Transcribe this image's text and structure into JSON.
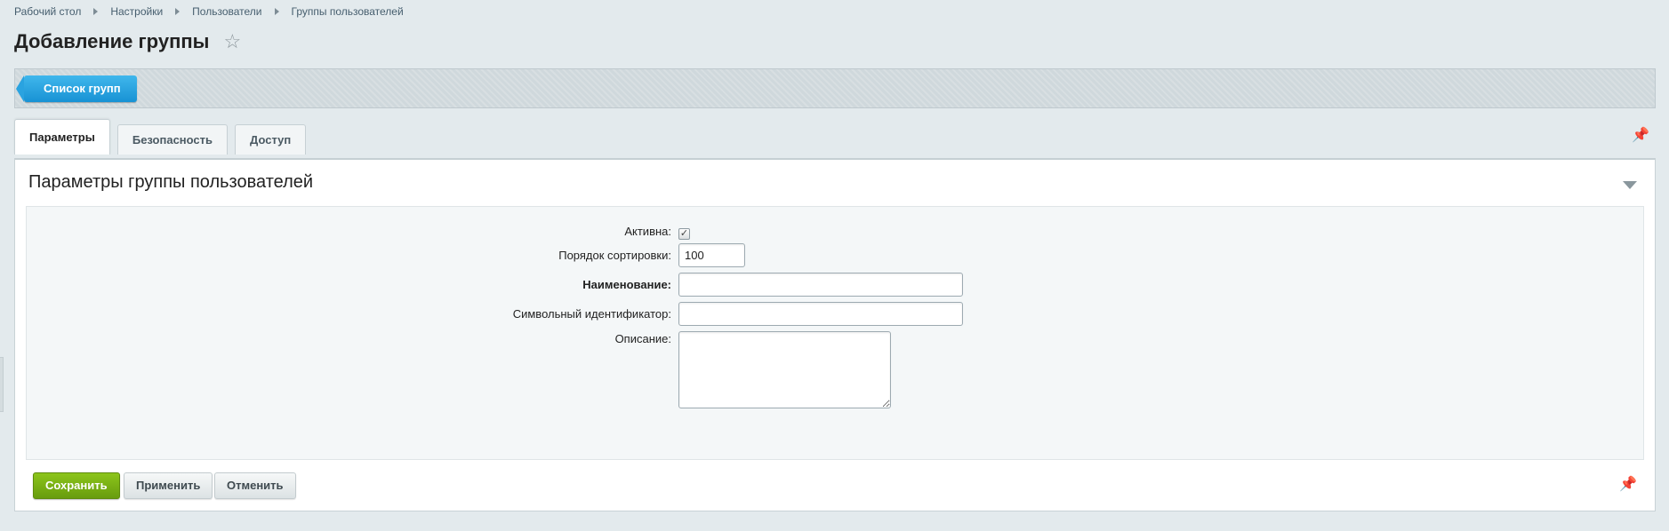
{
  "breadcrumb": [
    "Рабочий стол",
    "Настройки",
    "Пользователи",
    "Группы пользователей"
  ],
  "page": {
    "title": "Добавление группы"
  },
  "toolbar": {
    "list_button": "Список групп"
  },
  "tabs": [
    {
      "label": "Параметры",
      "active": true
    },
    {
      "label": "Безопасность",
      "active": false
    },
    {
      "label": "Доступ",
      "active": false
    }
  ],
  "section": {
    "title": "Параметры группы пользователей"
  },
  "form": {
    "active_label": "Активна:",
    "active_checked": true,
    "sort_label": "Порядок сортировки:",
    "sort_value": "100",
    "name_label": "Наименование:",
    "name_value": "",
    "code_label": "Символьный идентификатор:",
    "code_value": "",
    "description_label": "Описание:",
    "description_value": ""
  },
  "buttons": {
    "save": "Сохранить",
    "apply": "Применить",
    "cancel": "Отменить"
  },
  "colors": {
    "accent_blue": "#1d9ad9",
    "save_green": "#75a812",
    "background": "#e3eaed"
  },
  "icons": {
    "favorite": "star-icon",
    "pin": "pin-icon",
    "collapse": "chevron-down-icon",
    "check": "checkmark-icon"
  }
}
